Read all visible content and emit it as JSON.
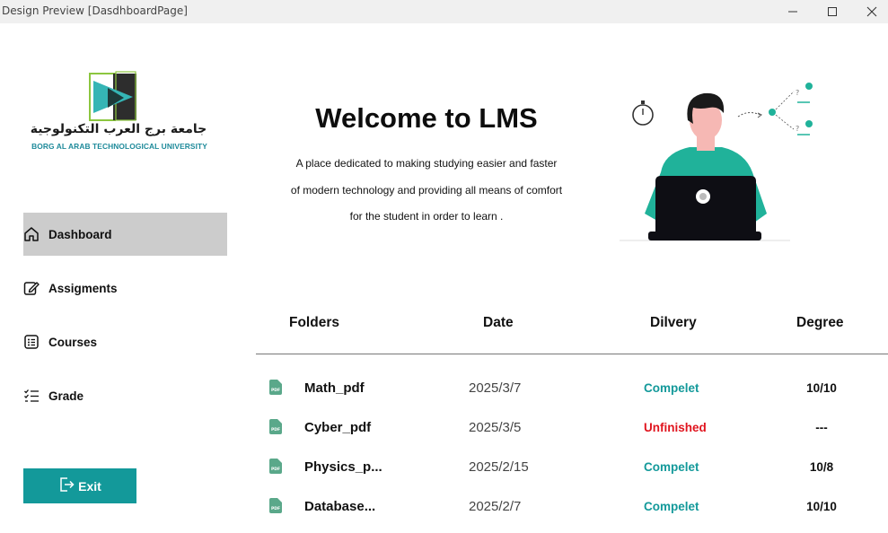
{
  "window": {
    "title": "Design Preview [DasdhboardPage]"
  },
  "logo": {
    "arabic_name": "جامعة برج العرب التكنولوجية",
    "english_name": "BORG AL ARAB TECHNOLOGICAL UNIVERSITY"
  },
  "sidebar": {
    "items": [
      {
        "label": "Dashboard",
        "icon": "home-icon",
        "active": true
      },
      {
        "label": "Assigments",
        "icon": "edit-icon",
        "active": false
      },
      {
        "label": "Courses",
        "icon": "list-icon",
        "active": false
      },
      {
        "label": "Grade",
        "icon": "checklist-icon",
        "active": false
      }
    ],
    "exit_label": "Exit",
    "exit_icon": "exit-icon"
  },
  "hero": {
    "title": "Welcome to LMS",
    "lines": [
      "A place dedicated to making studying easier and faster",
      "of modern technology  and providing all means of comfort",
      "for the student in order to learn ."
    ]
  },
  "table": {
    "headers": [
      "Folders",
      "Date",
      "Dilvery",
      "Degree"
    ],
    "rows": [
      {
        "name": "Math_pdf",
        "date": "2025/3/7",
        "status": "Compelet",
        "degree": "10/10"
      },
      {
        "name": "Cyber_pdf",
        "date": "2025/3/5",
        "status": "Unfinished",
        "degree": "---"
      },
      {
        "name": "Physics_p...",
        "date": "2025/2/15",
        "status": "Compelet",
        "degree": "10/8"
      },
      {
        "name": "Database...",
        "date": "2025/2/7",
        "status": "Compelet",
        "degree": "10/10"
      }
    ]
  },
  "colors": {
    "accent": "#13999a",
    "complete": "#13999a",
    "unfinished": "#e0141e",
    "active_nav": "#cccccc",
    "file_icon": "#5aa88a"
  }
}
